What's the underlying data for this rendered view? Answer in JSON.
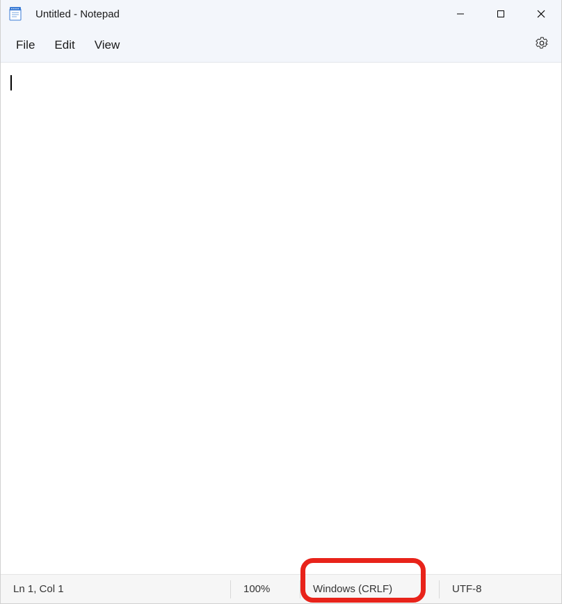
{
  "titlebar": {
    "title": "Untitled - Notepad"
  },
  "menubar": {
    "file": "File",
    "edit": "Edit",
    "view": "View"
  },
  "editor": {
    "content": ""
  },
  "statusbar": {
    "position": "Ln 1, Col 1",
    "zoom": "100%",
    "line_ending": "Windows (CRLF)",
    "encoding": "UTF-8"
  }
}
